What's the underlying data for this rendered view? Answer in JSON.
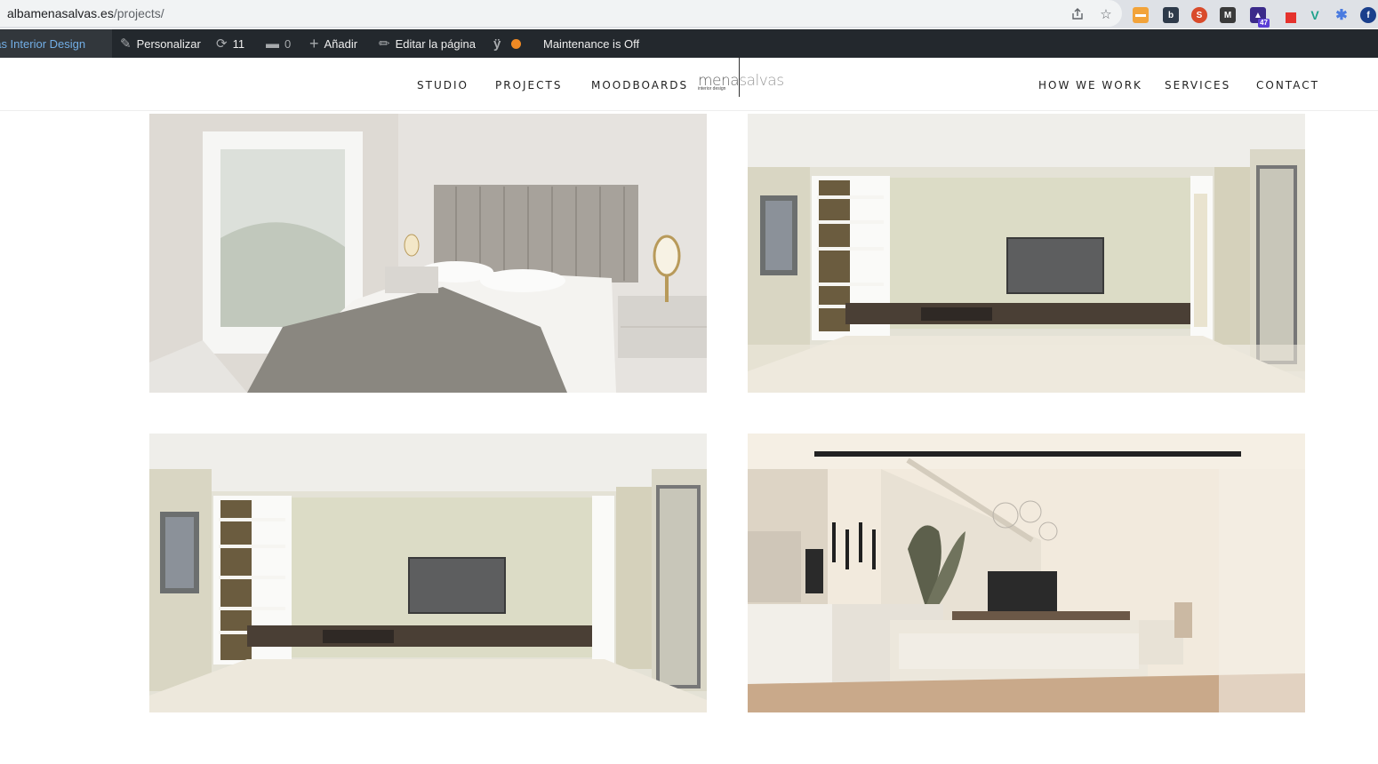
{
  "browser": {
    "url_host": "albamenasalvas.es",
    "url_path": "/projects/",
    "extensions": [
      {
        "name": "ext-1",
        "color": "#f2a33a",
        "label": ""
      },
      {
        "name": "ext-b",
        "color": "#2e3a4a",
        "label": "b"
      },
      {
        "name": "ext-s",
        "color": "#d94b2b",
        "label": "S"
      },
      {
        "name": "ext-m",
        "color": "#3a3a3a",
        "label": "M"
      },
      {
        "name": "ext-cap",
        "color": "#3b2a8a",
        "label": "",
        "badge": "47"
      },
      {
        "name": "ext-red",
        "color": "#e5322d",
        "label": ""
      },
      {
        "name": "ext-v",
        "color": "#1fa28c",
        "label": "V"
      },
      {
        "name": "ext-snow",
        "color": "#4a7be0",
        "label": "✱"
      },
      {
        "name": "ext-f",
        "color": "#1a3f8c",
        "label": "f"
      }
    ]
  },
  "adminbar": {
    "site_name": "albamenasalvas Interior Design",
    "customize": "Personalizar",
    "updates": "11",
    "comments": "0",
    "add_new": "Añadir",
    "edit_page": "Editar la página",
    "maintenance": "Maintenance is Off"
  },
  "nav": {
    "left": [
      "STUDIO",
      "PROJECTS",
      "MOODBOARDS"
    ],
    "right": [
      "HOW WE WORK",
      "SERVICES",
      "CONTACT"
    ],
    "logo_main_a": "mena",
    "logo_main_b": "salvas",
    "logo_sub": "interior design"
  },
  "projects": [
    {
      "name": "bedroom"
    },
    {
      "name": "living-room-tv-wall"
    },
    {
      "name": "living-room-tv-wall-2"
    },
    {
      "name": "open-plan-kitchen-living"
    }
  ]
}
